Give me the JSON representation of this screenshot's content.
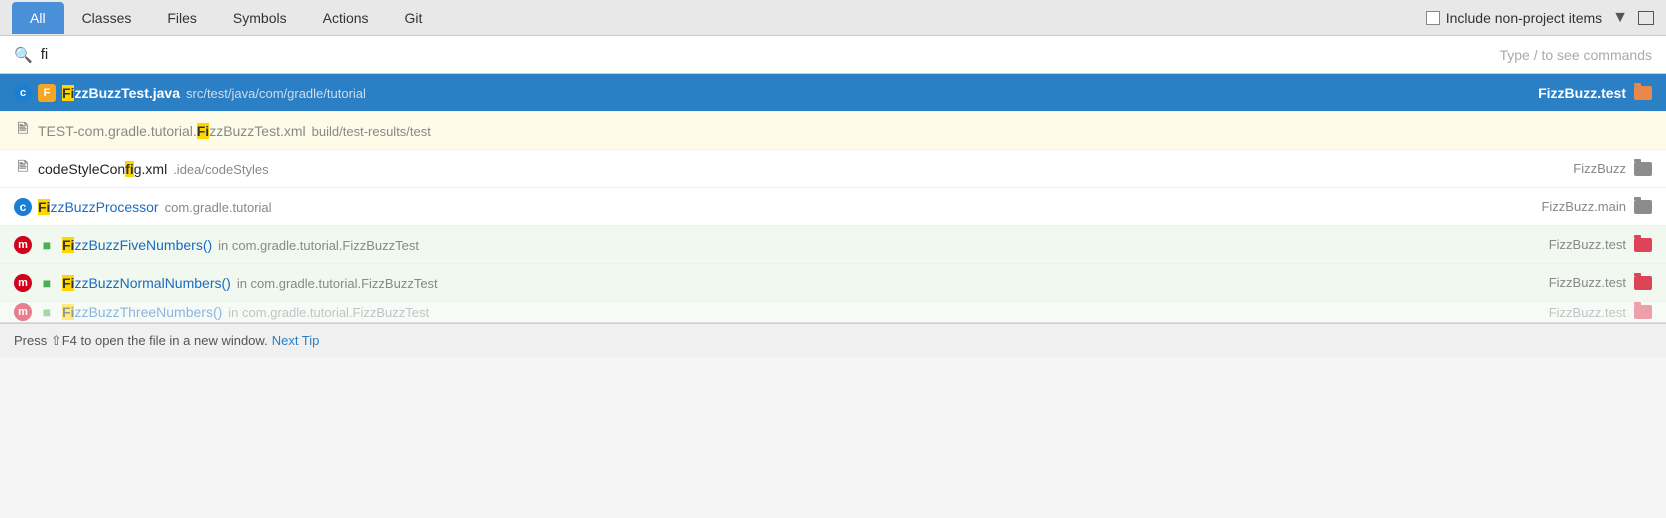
{
  "tabs": {
    "items": [
      {
        "label": "All",
        "active": true
      },
      {
        "label": "Classes",
        "active": false
      },
      {
        "label": "Files",
        "active": false
      },
      {
        "label": "Symbols",
        "active": false
      },
      {
        "label": "Actions",
        "active": false
      },
      {
        "label": "Git",
        "active": false
      }
    ],
    "include_non_project": "Include non-project items",
    "filter_tooltip": "Filter",
    "panel_tooltip": "Panel"
  },
  "search": {
    "query": "fi",
    "placeholder": "",
    "hint": "Type / to see commands"
  },
  "results": [
    {
      "id": "row1",
      "selected": true,
      "bg": "selected",
      "icon_type": "c-f",
      "filename_prefix": "",
      "filename_highlight": "Fi",
      "filename_rest": "zzBuzzTest.java",
      "path": "src/test/java/com/gradle/tutorial",
      "module": "FizzBuzz.test",
      "folder_type": "orange"
    },
    {
      "id": "row2",
      "selected": false,
      "bg": "yellow",
      "icon_type": "doc",
      "filename_prefix": "TEST-com.gradle.tutorial.",
      "filename_highlight": "Fi",
      "filename_rest": "zzBuzzTest.xml",
      "path": "build/test-results/test",
      "module": "",
      "folder_type": "none"
    },
    {
      "id": "row3",
      "selected": false,
      "bg": "white",
      "icon_type": "doc",
      "filename_prefix": "codeStyleCon",
      "filename_highlight": "fi",
      "filename_rest": "g.xml",
      "path": ".idea/codeStyles",
      "module": "FizzBuzz",
      "folder_type": "gray"
    },
    {
      "id": "row4",
      "selected": false,
      "bg": "white",
      "icon_type": "c-blue",
      "filename_prefix": "",
      "filename_highlight": "Fi",
      "filename_rest": "zzBuzzProcessor",
      "path": "com.gradle.tutorial",
      "module": "FizzBuzz.main",
      "folder_type": "gray"
    },
    {
      "id": "row5",
      "selected": false,
      "bg": "green",
      "icon_type": "m-green",
      "filename_prefix": "",
      "filename_highlight": "Fi",
      "filename_rest": "zzBuzzFiveNumbers()",
      "path": "in com.gradle.tutorial.FizzBuzzTest",
      "module": "FizzBuzz.test",
      "folder_type": "redorange"
    },
    {
      "id": "row6",
      "selected": false,
      "bg": "green",
      "icon_type": "m-green",
      "filename_prefix": "",
      "filename_highlight": "Fi",
      "filename_rest": "zzBuzzNormalNumbers()",
      "path": "in com.gradle.tutorial.FizzBuzzTest",
      "module": "FizzBuzz.test",
      "folder_type": "redorange"
    },
    {
      "id": "row7",
      "selected": false,
      "bg": "green",
      "icon_type": "m-green",
      "filename_prefix": "",
      "filename_highlight": "Fi",
      "filename_rest": "zzBuzz...",
      "path": "in com.gradle.tutorial.FizzBuzzTest...",
      "module": "FizzBuzz...",
      "folder_type": "redorange"
    }
  ],
  "status": {
    "press_text": "Press ⇧F4 to open the file in a new window.",
    "next_tip_label": "Next Tip"
  }
}
